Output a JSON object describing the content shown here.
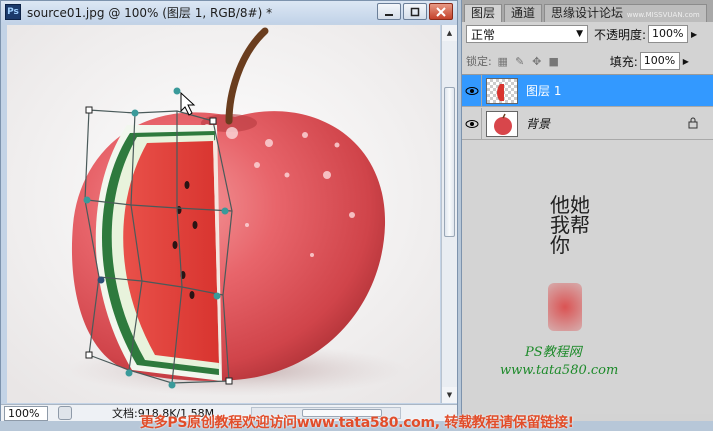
{
  "document": {
    "title": "source01.jpg @ 100% (图层 1, RGB/8#) *",
    "app_icon": "Ps",
    "window_buttons": [
      "minimize-icon",
      "restore-icon",
      "close-icon"
    ],
    "zoom": "100%",
    "doc_info": "文档:918.8K/1.58M"
  },
  "layers_panel": {
    "tabs": [
      "图层",
      "通道",
      "思缘设计论坛"
    ],
    "tab_url_fragment": "www.MISSVUAN.com",
    "blend_mode": "正常",
    "opacity_label": "不透明度:",
    "opacity_value": "100%",
    "lock_label": "锁定:",
    "fill_label": "填充:",
    "fill_value": "100%",
    "layers": [
      {
        "name": "图层 1",
        "visible": true,
        "selected": true
      },
      {
        "name": "背景",
        "visible": true,
        "selected": false,
        "locked": true
      }
    ]
  },
  "watermark": {
    "brush_text": "他她我帮你",
    "site_name": "PS教程网",
    "site_url": "www.tata580.com"
  },
  "banner": {
    "text": "更多PS原创教程欢迎访问www.tata580.com, 转载教程请保留链接!"
  },
  "colors": {
    "accent_selected": "#3399ff",
    "banner_text": "#e14d2a",
    "watermark_green": "#1d8a2a"
  }
}
